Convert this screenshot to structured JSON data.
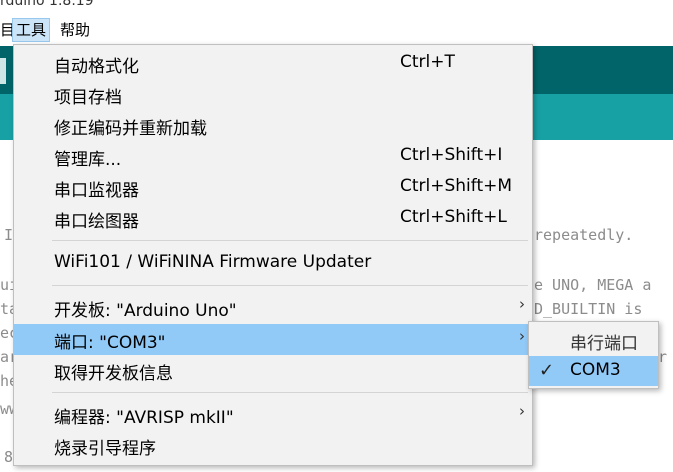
{
  "window": {
    "title": "rduino 1.8.19"
  },
  "menubar": {
    "items": [
      "目",
      "工具",
      "帮助"
    ]
  },
  "editor": {
    "lines": [
      "I",
      "ui",
      "ta",
      "ec",
      "ar",
      "he",
      "ww",
      "8",
      "repeatedly.",
      "e UNO, MEGA a",
      "D_BUILTIN is",
      "r"
    ]
  },
  "tools_menu": {
    "items": [
      {
        "label": "自动格式化",
        "shortcut": "Ctrl+T"
      },
      {
        "label": "项目存档",
        "shortcut": ""
      },
      {
        "label": "修正编码并重新加载",
        "shortcut": ""
      },
      {
        "label": "管理库...",
        "shortcut": "Ctrl+Shift+I"
      },
      {
        "label": "串口监视器",
        "shortcut": "Ctrl+Shift+M"
      },
      {
        "label": "串口绘图器",
        "shortcut": "Ctrl+Shift+L"
      },
      {
        "label": "WiFi101 / WiFiNINA Firmware Updater",
        "shortcut": ""
      },
      {
        "label": "开发板: \"Arduino Uno\"",
        "shortcut": ""
      },
      {
        "label": "端口: \"COM3\"",
        "shortcut": ""
      },
      {
        "label": "取得开发板信息",
        "shortcut": ""
      },
      {
        "label": "编程器: \"AVRISP mkII\"",
        "shortcut": ""
      },
      {
        "label": "烧录引导程序",
        "shortcut": ""
      }
    ],
    "highlighted": "端口: \"COM3\"",
    "submenu_arrow": "›"
  },
  "port_submenu": {
    "header": "串行端口",
    "items": [
      {
        "label": "COM3",
        "checked": true,
        "check_glyph": "✓"
      }
    ]
  },
  "colors": {
    "toolbar_dark": "#006468",
    "toolbar_light": "#17a1a5",
    "highlight": "#91c9f7"
  }
}
